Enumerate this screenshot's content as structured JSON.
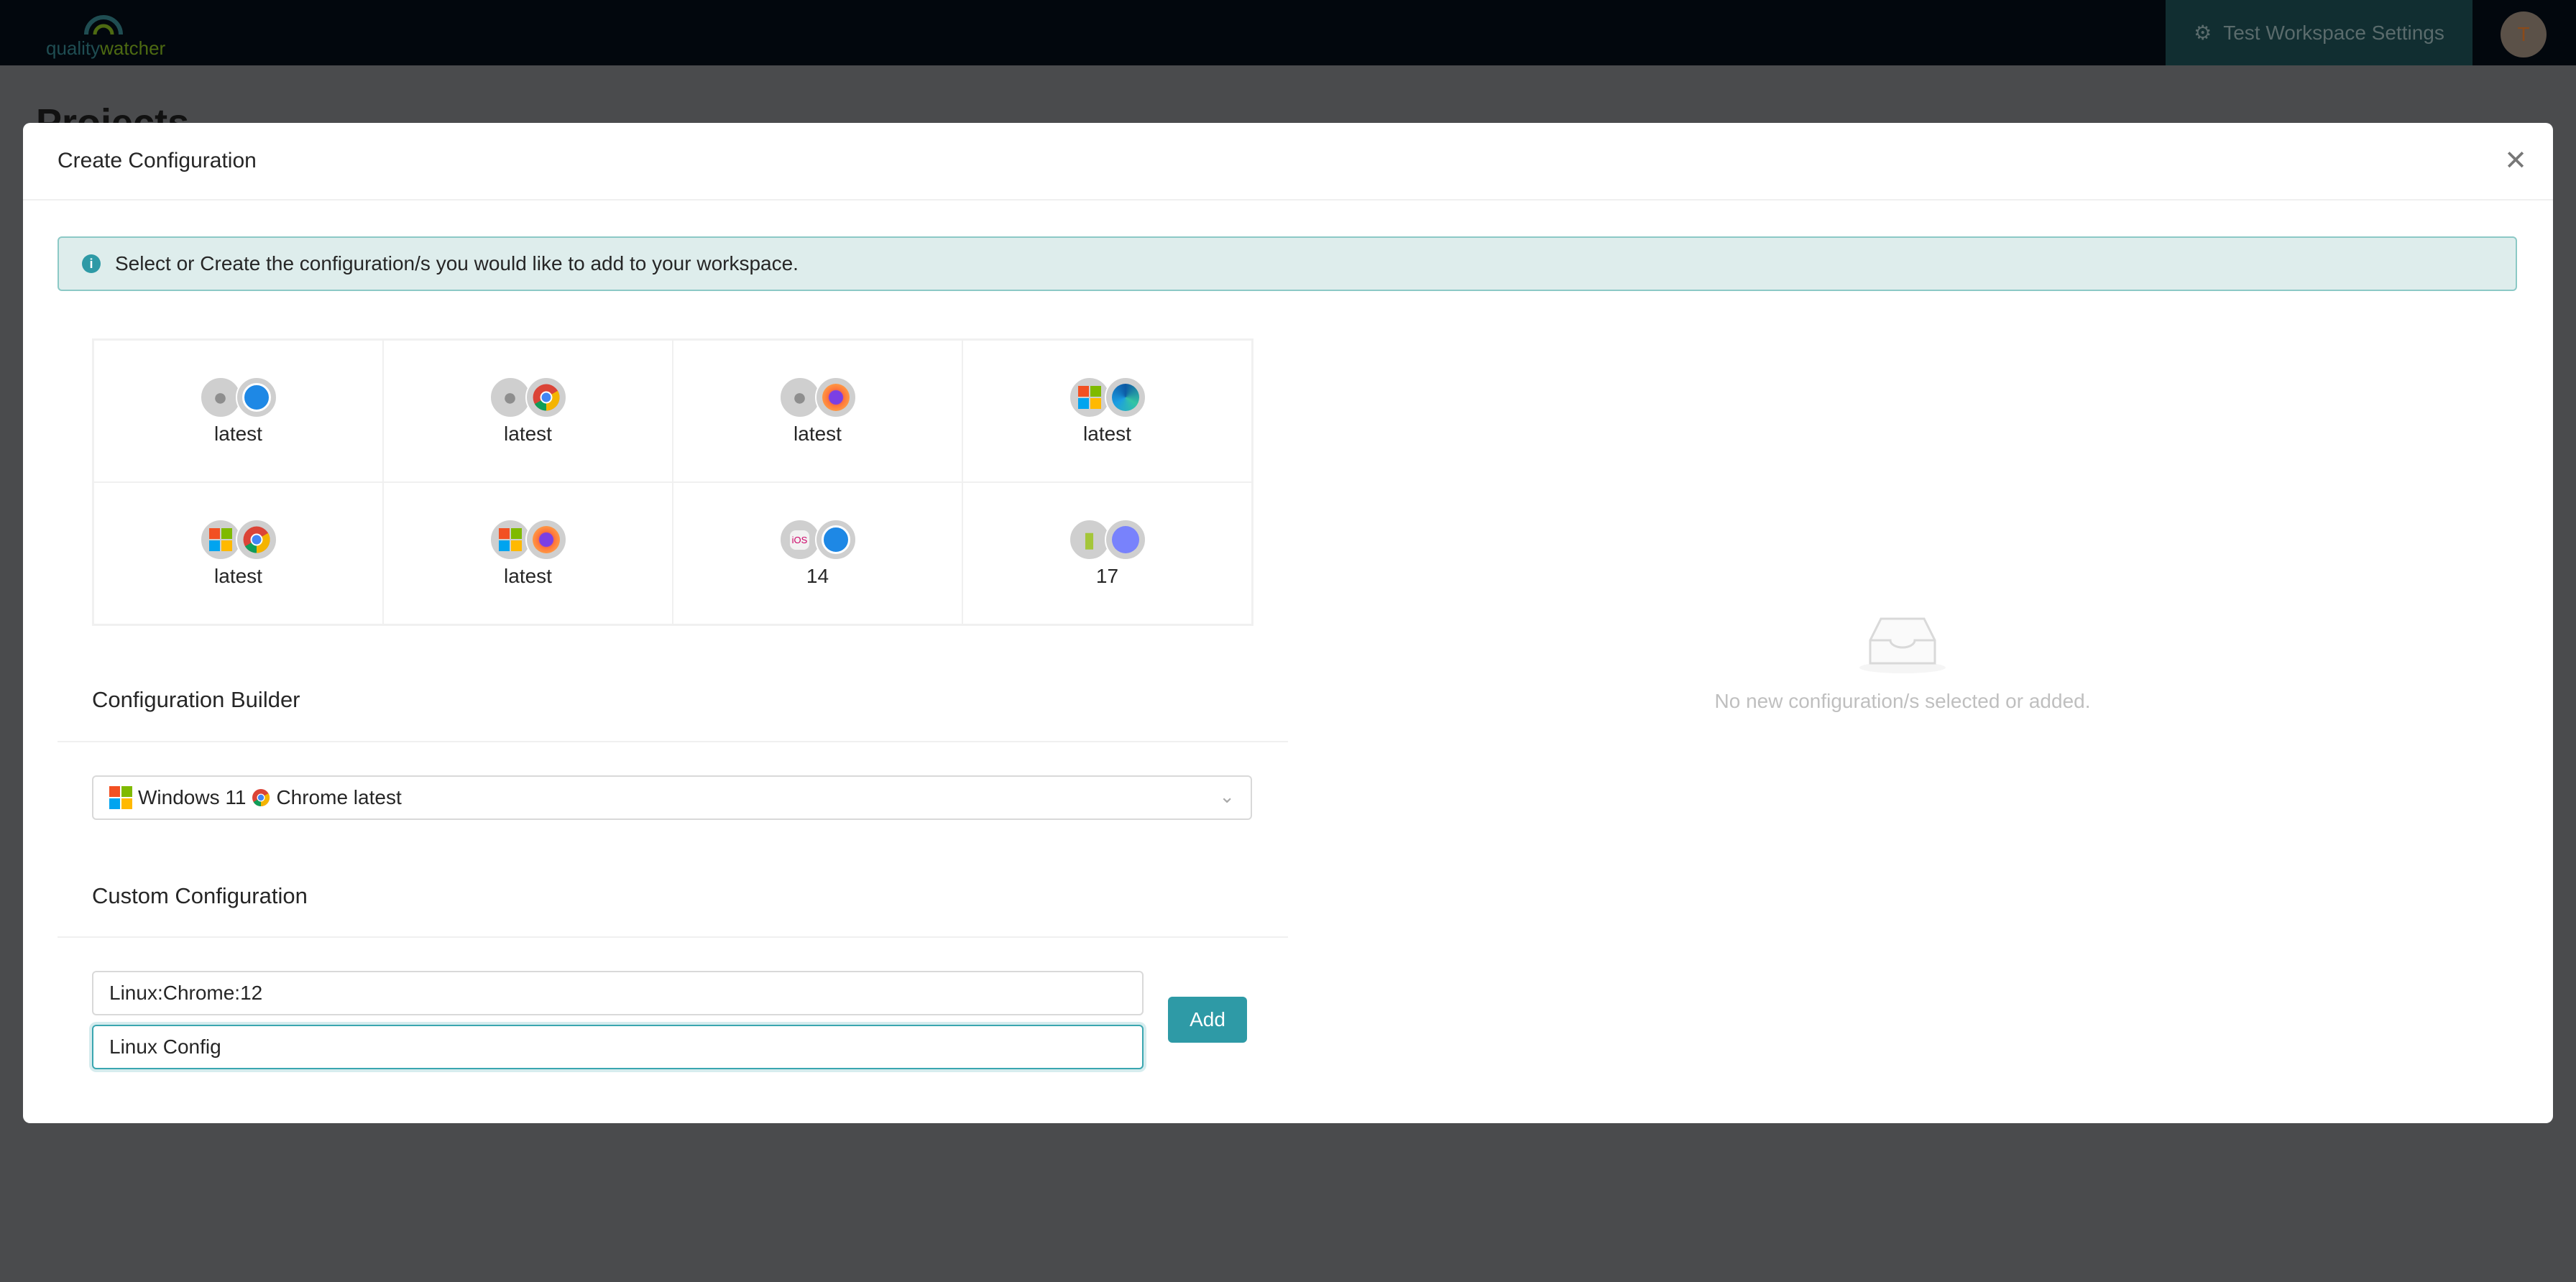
{
  "topbar": {
    "logo_left": "quality",
    "logo_right": "watcher",
    "settings_label": "Test Workspace Settings",
    "avatar_initial": "T"
  },
  "background": {
    "page_title": "Projects"
  },
  "modal": {
    "title": "Create Configuration",
    "alert": "Select or Create the configuration/s you would like to add to your workspace.",
    "presets": [
      {
        "os": "apple",
        "browser": "safari",
        "version": "latest"
      },
      {
        "os": "apple",
        "browser": "chrome",
        "version": "latest"
      },
      {
        "os": "apple",
        "browser": "firefox",
        "version": "latest"
      },
      {
        "os": "windows",
        "browser": "edge",
        "version": "latest"
      },
      {
        "os": "windows",
        "browser": "chrome",
        "version": "latest"
      },
      {
        "os": "windows",
        "browser": "firefox",
        "version": "latest"
      },
      {
        "os": "ios",
        "browser": "safari",
        "version": "14"
      },
      {
        "os": "android",
        "browser": "samsung-internet",
        "version": "17"
      }
    ],
    "builder_title": "Configuration Builder",
    "builder_select": {
      "os": "Windows 11",
      "browser": "Chrome latest"
    },
    "custom_title": "Custom Configuration",
    "custom_config_value": "Linux:Chrome:12",
    "custom_name_value": "Linux Config",
    "add_label": "Add",
    "empty_text": "No new configuration/s selected or added.",
    "ios_badge": "iOS"
  },
  "colors": {
    "accent": "#2e9aa6",
    "alert_bg": "#deedec",
    "topbar": "#02070d"
  }
}
